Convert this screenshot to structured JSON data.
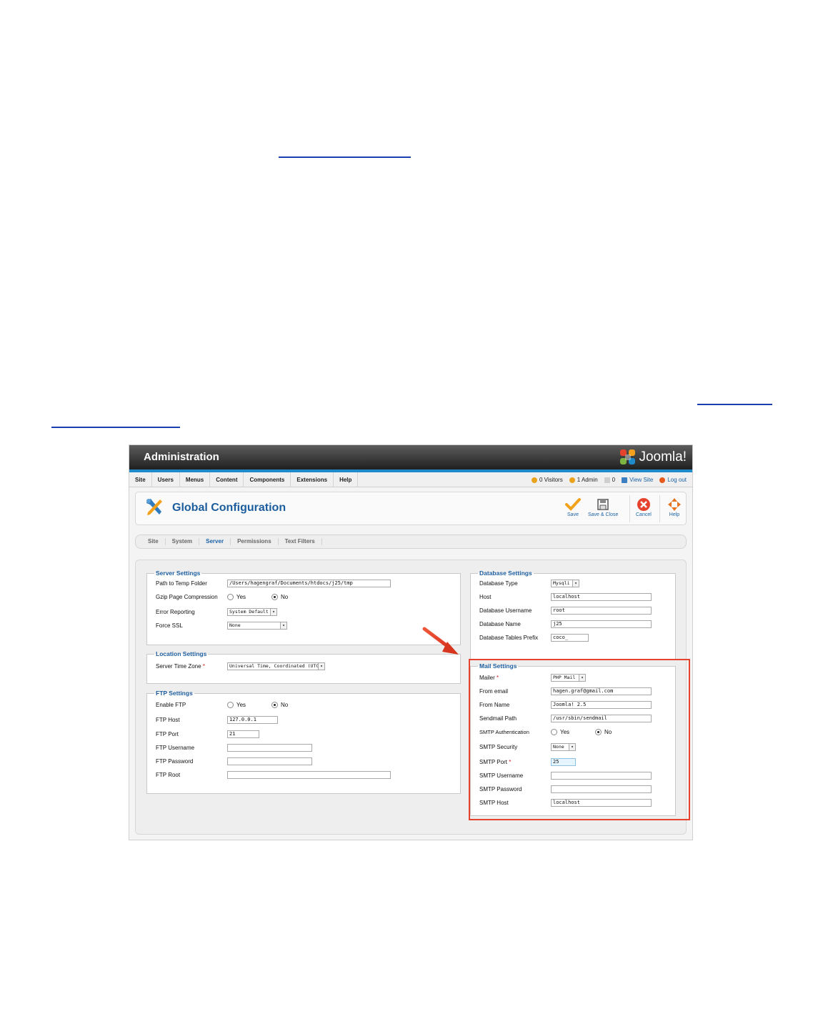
{
  "header": {
    "title": "Administration",
    "brand": "Joomla!"
  },
  "menu": [
    "Site",
    "Users",
    "Menus",
    "Content",
    "Components",
    "Extensions",
    "Help"
  ],
  "status": {
    "visitors": "0 Visitors",
    "admin": "1 Admin",
    "messages": "0",
    "view_site": "View Site",
    "logout": "Log out"
  },
  "page": {
    "title": "Global Configuration"
  },
  "toolbar": {
    "save": "Save",
    "save_close": "Save & Close",
    "cancel": "Cancel",
    "help": "Help"
  },
  "tabs": [
    "Site",
    "System",
    "Server",
    "Permissions",
    "Text Filters"
  ],
  "server": {
    "legend": "Server Settings",
    "temp_label": "Path to Temp Folder",
    "temp_value": "/Users/hagengraf/Documents/htdocs/j25/tmp",
    "gzip_label": "Gzip Page Compression",
    "yes": "Yes",
    "no": "No",
    "error_label": "Error Reporting",
    "error_value": "System Default",
    "ssl_label": "Force SSL",
    "ssl_value": "None"
  },
  "location": {
    "legend": "Location Settings",
    "tz_label": "Server Time Zone",
    "tz_value": "Universal Time, Coordinated (UTC)"
  },
  "ftp": {
    "legend": "FTP Settings",
    "enable_label": "Enable FTP",
    "yes": "Yes",
    "no": "No",
    "host_label": "FTP Host",
    "host_value": "127.0.0.1",
    "port_label": "FTP Port",
    "port_value": "21",
    "user_label": "FTP Username",
    "pass_label": "FTP Password",
    "root_label": "FTP Root"
  },
  "database": {
    "legend": "Database Settings",
    "type_label": "Database Type",
    "type_value": "Mysqli",
    "host_label": "Host",
    "host_value": "localhost",
    "user_label": "Database Username",
    "user_value": "root",
    "name_label": "Database Name",
    "name_value": "j25",
    "prefix_label": "Database Tables Prefix",
    "prefix_value": "coco_"
  },
  "mail": {
    "legend": "Mail Settings",
    "mailer_label": "Mailer",
    "mailer_value": "PHP Mail",
    "from_email_label": "From email",
    "from_email_value": "hagen.graf@gmail.com",
    "from_name_label": "From Name",
    "from_name_value": "Joomla! 2.5",
    "sendmail_label": "Sendmail Path",
    "sendmail_value": "/usr/sbin/sendmail",
    "smtp_auth_label": "SMTP Authentication",
    "yes": "Yes",
    "no": "No",
    "smtp_security_label": "SMTP Security",
    "smtp_security_value": "None",
    "smtp_port_label": "SMTP Port",
    "smtp_port_value": "25",
    "smtp_user_label": "SMTP Username",
    "smtp_pass_label": "SMTP Password",
    "smtp_host_label": "SMTP Host",
    "smtp_host_value": "localhost"
  },
  "colors": {
    "accent": "#1c5d9e",
    "highlight": "#e5432e",
    "stripe": "#1f8ac9"
  }
}
